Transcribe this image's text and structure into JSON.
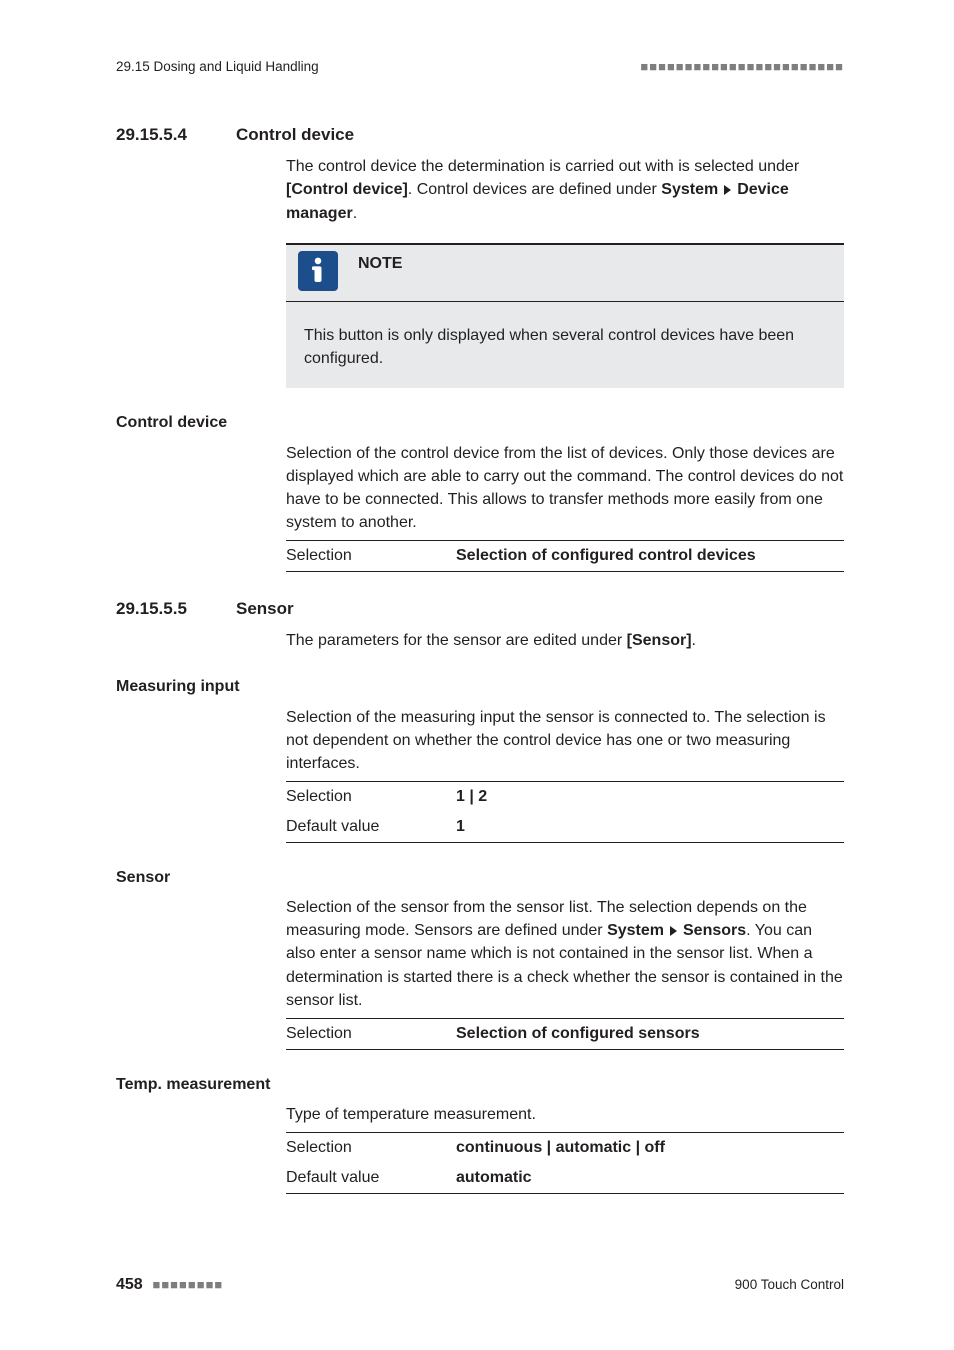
{
  "header": {
    "section_path": "29.15 Dosing and Liquid Handling",
    "marks": "■■■■■■■■■■■■■■■■■■■■■■■"
  },
  "s1": {
    "num": "29.15.5.4",
    "title": "Control device",
    "intro_a": "The control device the determination is carried out with is selected under ",
    "intro_b": "[Control device]",
    "intro_c": ". Control devices are defined under ",
    "intro_d": "System",
    "intro_e": "Device manager",
    "intro_f": ".",
    "note_label": "NOTE",
    "note_body": "This button is only displayed when several control devices have been configured.",
    "side": "Control device",
    "desc": "Selection of the control device from the list of devices. Only those devices are displayed which are able to carry out the command. The control devices do not have to be connected. This allows to transfer methods more easily from one system to another.",
    "row_k": "Selection",
    "row_v": "Selection of configured control devices"
  },
  "s2": {
    "num": "29.15.5.5",
    "title": "Sensor",
    "intro_a": "The parameters for the sensor are edited under ",
    "intro_b": "[Sensor]",
    "intro_c": ".",
    "mi": {
      "side": "Measuring input",
      "desc": "Selection of the measuring input the sensor is connected to. The selection is not dependent on whether the control device has one or two measuring interfaces.",
      "r1k": "Selection",
      "r1v": "1 | 2",
      "r2k": "Default value",
      "r2v": "1"
    },
    "sn": {
      "side": "Sensor",
      "desc_a": "Selection of the sensor from the sensor list. The selection depends on the measuring mode. Sensors are defined under ",
      "desc_b": "System",
      "desc_c": "Sensors",
      "desc_d": ". You can also enter a sensor name which is not contained in the sensor list. When a determination is started there is a check whether the sensor is contained in the sensor list.",
      "r1k": "Selection",
      "r1v": "Selection of configured sensors"
    },
    "tm": {
      "side": "Temp. measurement",
      "desc": "Type of temperature measurement.",
      "r1k": "Selection",
      "r1v": "continuous | automatic | off",
      "r2k": "Default value",
      "r2v": "automatic"
    }
  },
  "footer": {
    "page": "458",
    "dots": "■■■■■■■■",
    "product": "900 Touch Control"
  }
}
